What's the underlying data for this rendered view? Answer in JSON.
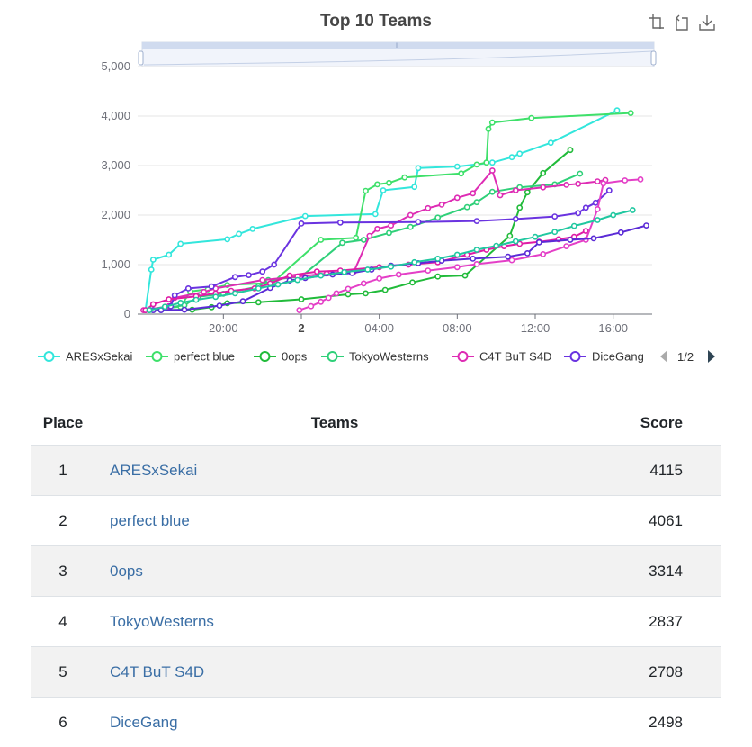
{
  "chart_data": {
    "type": "line",
    "title": "Top 10 Teams",
    "x_axis_type": "time",
    "x_tick_labels": [
      "20:00",
      "2",
      "04:00",
      "08:00",
      "12:00",
      "16:00"
    ],
    "y_tick_labels": [
      "0",
      "1,000",
      "2,000",
      "3,000",
      "4,000",
      "5,000"
    ],
    "ylim": [
      0,
      5000
    ],
    "grid": true,
    "legend_position": "bottom",
    "legend_page": "1/2",
    "series": [
      {
        "name": "ARESxSekai",
        "color": "#33e6dc",
        "points": [
          [
            16.0,
            80
          ],
          [
            16.3,
            900
          ],
          [
            16.4,
            1100
          ],
          [
            17.2,
            1200
          ],
          [
            17.8,
            1420
          ],
          [
            20.2,
            1510
          ],
          [
            20.8,
            1620
          ],
          [
            21.5,
            1720
          ],
          [
            24.2,
            1980
          ],
          [
            27.8,
            2020
          ],
          [
            28.2,
            2500
          ],
          [
            29.8,
            2570
          ],
          [
            30.0,
            2950
          ],
          [
            32.0,
            2980
          ],
          [
            33.8,
            3060
          ],
          [
            34.8,
            3170
          ],
          [
            35.2,
            3240
          ],
          [
            36.8,
            3460
          ],
          [
            40.2,
            4115
          ]
        ]
      },
      {
        "name": "perfect blue",
        "color": "#3ee06a",
        "points": [
          [
            16.2,
            90
          ],
          [
            17.8,
            150
          ],
          [
            18.3,
            460
          ],
          [
            19.2,
            500
          ],
          [
            20.2,
            590
          ],
          [
            22.5,
            630
          ],
          [
            25.0,
            1500
          ],
          [
            26.8,
            1540
          ],
          [
            27.3,
            2490
          ],
          [
            27.9,
            2620
          ],
          [
            28.5,
            2650
          ],
          [
            29.3,
            2760
          ],
          [
            32.2,
            2840
          ],
          [
            33.0,
            3020
          ],
          [
            33.5,
            3060
          ],
          [
            33.6,
            3740
          ],
          [
            33.8,
            3870
          ],
          [
            35.8,
            3960
          ],
          [
            40.9,
            4061
          ]
        ]
      },
      {
        "name": "0ops",
        "color": "#21bb3a",
        "points": [
          [
            16.4,
            80
          ],
          [
            18.4,
            90
          ],
          [
            19.4,
            140
          ],
          [
            20.2,
            220
          ],
          [
            21.8,
            240
          ],
          [
            24.0,
            300
          ],
          [
            26.4,
            400
          ],
          [
            27.3,
            420
          ],
          [
            28.3,
            490
          ],
          [
            29.7,
            640
          ],
          [
            31.0,
            760
          ],
          [
            32.4,
            780
          ],
          [
            34.7,
            1580
          ],
          [
            35.2,
            2150
          ],
          [
            35.6,
            2460
          ],
          [
            36.4,
            2850
          ],
          [
            37.8,
            3314
          ]
        ]
      },
      {
        "name": "TokyoWesterns",
        "color": "#2fd079",
        "points": [
          [
            16.2,
            80
          ],
          [
            18.0,
            180
          ],
          [
            18.7,
            350
          ],
          [
            20.0,
            410
          ],
          [
            21.8,
            560
          ],
          [
            22.3,
            690
          ],
          [
            24.0,
            760
          ],
          [
            26.1,
            1440
          ],
          [
            27.2,
            1500
          ],
          [
            28.5,
            1640
          ],
          [
            29.6,
            1760
          ],
          [
            31.0,
            1950
          ],
          [
            32.5,
            2160
          ],
          [
            33.0,
            2260
          ],
          [
            33.8,
            2470
          ],
          [
            35.2,
            2560
          ],
          [
            37.0,
            2620
          ],
          [
            38.3,
            2837
          ]
        ]
      },
      {
        "name": "C4T BuT S4D",
        "color": "#de2cb4",
        "points": [
          [
            15.9,
            80
          ],
          [
            17.2,
            160
          ],
          [
            17.5,
            330
          ],
          [
            19.0,
            450
          ],
          [
            19.6,
            520
          ],
          [
            22.0,
            690
          ],
          [
            23.8,
            760
          ],
          [
            25.3,
            820
          ],
          [
            26.7,
            860
          ],
          [
            27.5,
            1580
          ],
          [
            27.9,
            1720
          ],
          [
            28.6,
            1790
          ],
          [
            29.6,
            2000
          ],
          [
            30.5,
            2140
          ],
          [
            31.2,
            2210
          ],
          [
            32.0,
            2350
          ],
          [
            32.8,
            2440
          ],
          [
            33.8,
            2900
          ],
          [
            34.2,
            2400
          ],
          [
            35.0,
            2500
          ],
          [
            36.4,
            2560
          ],
          [
            37.6,
            2610
          ],
          [
            38.2,
            2630
          ],
          [
            39.2,
            2680
          ],
          [
            39.6,
            2708
          ]
        ]
      },
      {
        "name": "DiceGang",
        "color": "#6a33e0",
        "points": [
          [
            16.4,
            80
          ],
          [
            17.3,
            160
          ],
          [
            17.5,
            380
          ],
          [
            18.2,
            520
          ],
          [
            19.4,
            560
          ],
          [
            20.6,
            750
          ],
          [
            21.3,
            790
          ],
          [
            22.0,
            860
          ],
          [
            22.6,
            1000
          ],
          [
            24.0,
            1830
          ],
          [
            26.0,
            1850
          ],
          [
            30.0,
            1860
          ],
          [
            33.0,
            1880
          ],
          [
            35.0,
            1920
          ],
          [
            37.0,
            1970
          ],
          [
            38.2,
            2040
          ],
          [
            38.6,
            2150
          ],
          [
            39.1,
            2250
          ],
          [
            39.8,
            2498
          ]
        ]
      },
      {
        "name": "",
        "color": "#e01ca6",
        "points": [
          [
            16.0,
            80
          ],
          [
            16.4,
            200
          ],
          [
            17.2,
            300
          ],
          [
            18.6,
            360
          ],
          [
            19.6,
            420
          ],
          [
            20.4,
            470
          ],
          [
            21.6,
            520
          ],
          [
            22.4,
            620
          ],
          [
            23.4,
            780
          ],
          [
            24.8,
            860
          ],
          [
            26.0,
            880
          ],
          [
            28.0,
            950
          ],
          [
            29.5,
            1000
          ],
          [
            31.0,
            1050
          ],
          [
            32.5,
            1200
          ],
          [
            33.5,
            1300
          ],
          [
            34.4,
            1370
          ],
          [
            35.2,
            1420
          ],
          [
            36.2,
            1460
          ],
          [
            37.2,
            1510
          ],
          [
            38.0,
            1560
          ],
          [
            38.6,
            1680
          ]
        ]
      },
      {
        "name": "",
        "color": "#e43fc7",
        "points": [
          [
            23.9,
            80
          ],
          [
            24.5,
            160
          ],
          [
            25.0,
            250
          ],
          [
            25.4,
            330
          ],
          [
            25.8,
            420
          ],
          [
            26.4,
            510
          ],
          [
            27.2,
            620
          ],
          [
            28.0,
            720
          ],
          [
            29.0,
            800
          ],
          [
            30.5,
            880
          ],
          [
            32.0,
            950
          ],
          [
            33.0,
            1010
          ],
          [
            34.8,
            1090
          ],
          [
            36.4,
            1210
          ],
          [
            37.6,
            1370
          ],
          [
            38.6,
            1500
          ],
          [
            39.2,
            2120
          ],
          [
            39.5,
            2640
          ],
          [
            40.6,
            2700
          ],
          [
            41.4,
            2720
          ]
        ]
      },
      {
        "name": "",
        "color": "#5b2bd6",
        "points": [
          [
            16.8,
            80
          ],
          [
            18.0,
            90
          ],
          [
            19.8,
            170
          ],
          [
            21.0,
            260
          ],
          [
            22.4,
            530
          ],
          [
            23.4,
            680
          ],
          [
            24.2,
            730
          ],
          [
            25.6,
            800
          ],
          [
            26.6,
            830
          ],
          [
            27.6,
            900
          ],
          [
            28.6,
            980
          ],
          [
            30.0,
            1030
          ],
          [
            31.2,
            1080
          ],
          [
            32.8,
            1120
          ],
          [
            34.6,
            1160
          ],
          [
            35.6,
            1230
          ],
          [
            36.2,
            1450
          ],
          [
            37.8,
            1500
          ],
          [
            39.0,
            1530
          ],
          [
            40.4,
            1650
          ],
          [
            41.7,
            1790
          ]
        ]
      },
      {
        "name": "",
        "color": "#20c8a0",
        "points": [
          [
            16.2,
            80
          ],
          [
            17.0,
            150
          ],
          [
            17.8,
            230
          ],
          [
            18.6,
            290
          ],
          [
            19.6,
            350
          ],
          [
            20.6,
            420
          ],
          [
            21.8,
            520
          ],
          [
            22.8,
            600
          ],
          [
            23.8,
            690
          ],
          [
            25.0,
            780
          ],
          [
            26.2,
            850
          ],
          [
            27.4,
            900
          ],
          [
            28.6,
            960
          ],
          [
            29.8,
            1050
          ],
          [
            31.0,
            1120
          ],
          [
            32.0,
            1200
          ],
          [
            33.0,
            1300
          ],
          [
            34.0,
            1380
          ],
          [
            35.0,
            1470
          ],
          [
            36.0,
            1560
          ],
          [
            37.0,
            1660
          ],
          [
            38.0,
            1780
          ],
          [
            39.2,
            1900
          ],
          [
            40.0,
            2000
          ],
          [
            41.0,
            2100
          ]
        ]
      }
    ]
  },
  "legend": {
    "items": [
      {
        "label": "ARESxSekai",
        "color": "#33e6dc"
      },
      {
        "label": "perfect blue",
        "color": "#3ee06a"
      },
      {
        "label": "0ops",
        "color": "#21bb3a"
      },
      {
        "label": "TokyoWesterns",
        "color": "#2fd079"
      },
      {
        "label": "C4T BuT S4D",
        "color": "#de2cb4"
      },
      {
        "label": "DiceGang",
        "color": "#6a33e0"
      }
    ],
    "page": "1/2"
  },
  "toolbox": {
    "icons": [
      "zoom-icon",
      "zoom-reset-icon",
      "save-image-icon"
    ]
  },
  "table": {
    "headers": {
      "place": "Place",
      "teams": "Teams",
      "score": "Score"
    },
    "rows": [
      {
        "place": "1",
        "team": "ARESxSekai",
        "score": "4115"
      },
      {
        "place": "2",
        "team": "perfect blue",
        "score": "4061"
      },
      {
        "place": "3",
        "team": "0ops",
        "score": "3314"
      },
      {
        "place": "4",
        "team": "TokyoWesterns",
        "score": "2837"
      },
      {
        "place": "5",
        "team": "C4T BuT S4D",
        "score": "2708"
      },
      {
        "place": "6",
        "team": "DiceGang",
        "score": "2498"
      }
    ]
  }
}
